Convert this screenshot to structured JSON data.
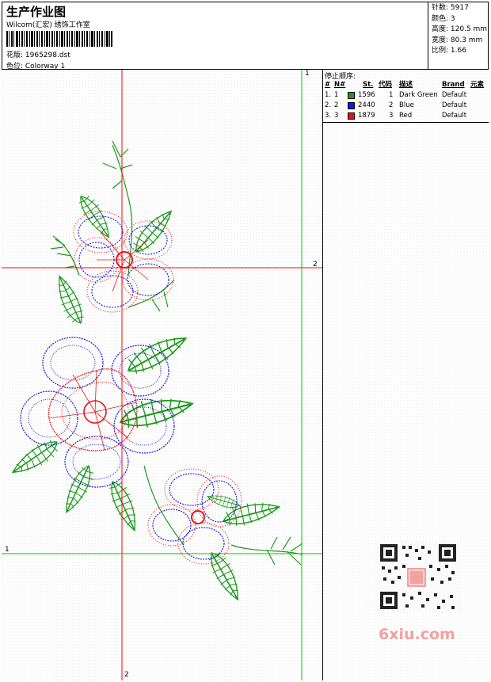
{
  "header": {
    "title": "生产作业图",
    "subtitle": "Wilcom(汇宏) 绣饰工作室",
    "design_label": "花版: 1965298.dst",
    "color_label": "色位: Colorway 1"
  },
  "stats": {
    "stitches": "针数: 5917",
    "colors": "颜色: 3",
    "height": "高度: 120.5 mm",
    "width": "宽度: 80.3 mm",
    "scale": "比例: 1.66"
  },
  "stop_sequence": {
    "heading": "停止顺序:",
    "columns": {
      "num": "#",
      "n": "N#",
      "st": "St.",
      "code": "代码",
      "desc": "描述",
      "brand": "Brand",
      "elem": "元素"
    },
    "rows": [
      {
        "num": "1.",
        "n": "1",
        "color": "#1a9a1a",
        "st": "1596",
        "code": "1",
        "desc": "Dark Green",
        "brand": "Default"
      },
      {
        "num": "2.",
        "n": "2",
        "color": "#1414e6",
        "st": "2440",
        "code": "2",
        "desc": "Blue",
        "brand": "Default"
      },
      {
        "num": "3.",
        "n": "3",
        "color": "#e81414",
        "st": "1879",
        "code": "3",
        "desc": "Red",
        "brand": "Default"
      }
    ]
  },
  "guides": {
    "red_v": "2",
    "red_h": "2",
    "green_v": "1",
    "green_h": "1"
  },
  "watermark": {
    "text": "6xiu.com"
  },
  "colors": {
    "green": "#1a9a1a",
    "blue": "#1414e6",
    "red": "#e81414",
    "guide_red": "#ff0000",
    "guide_green": "#00cc00"
  }
}
